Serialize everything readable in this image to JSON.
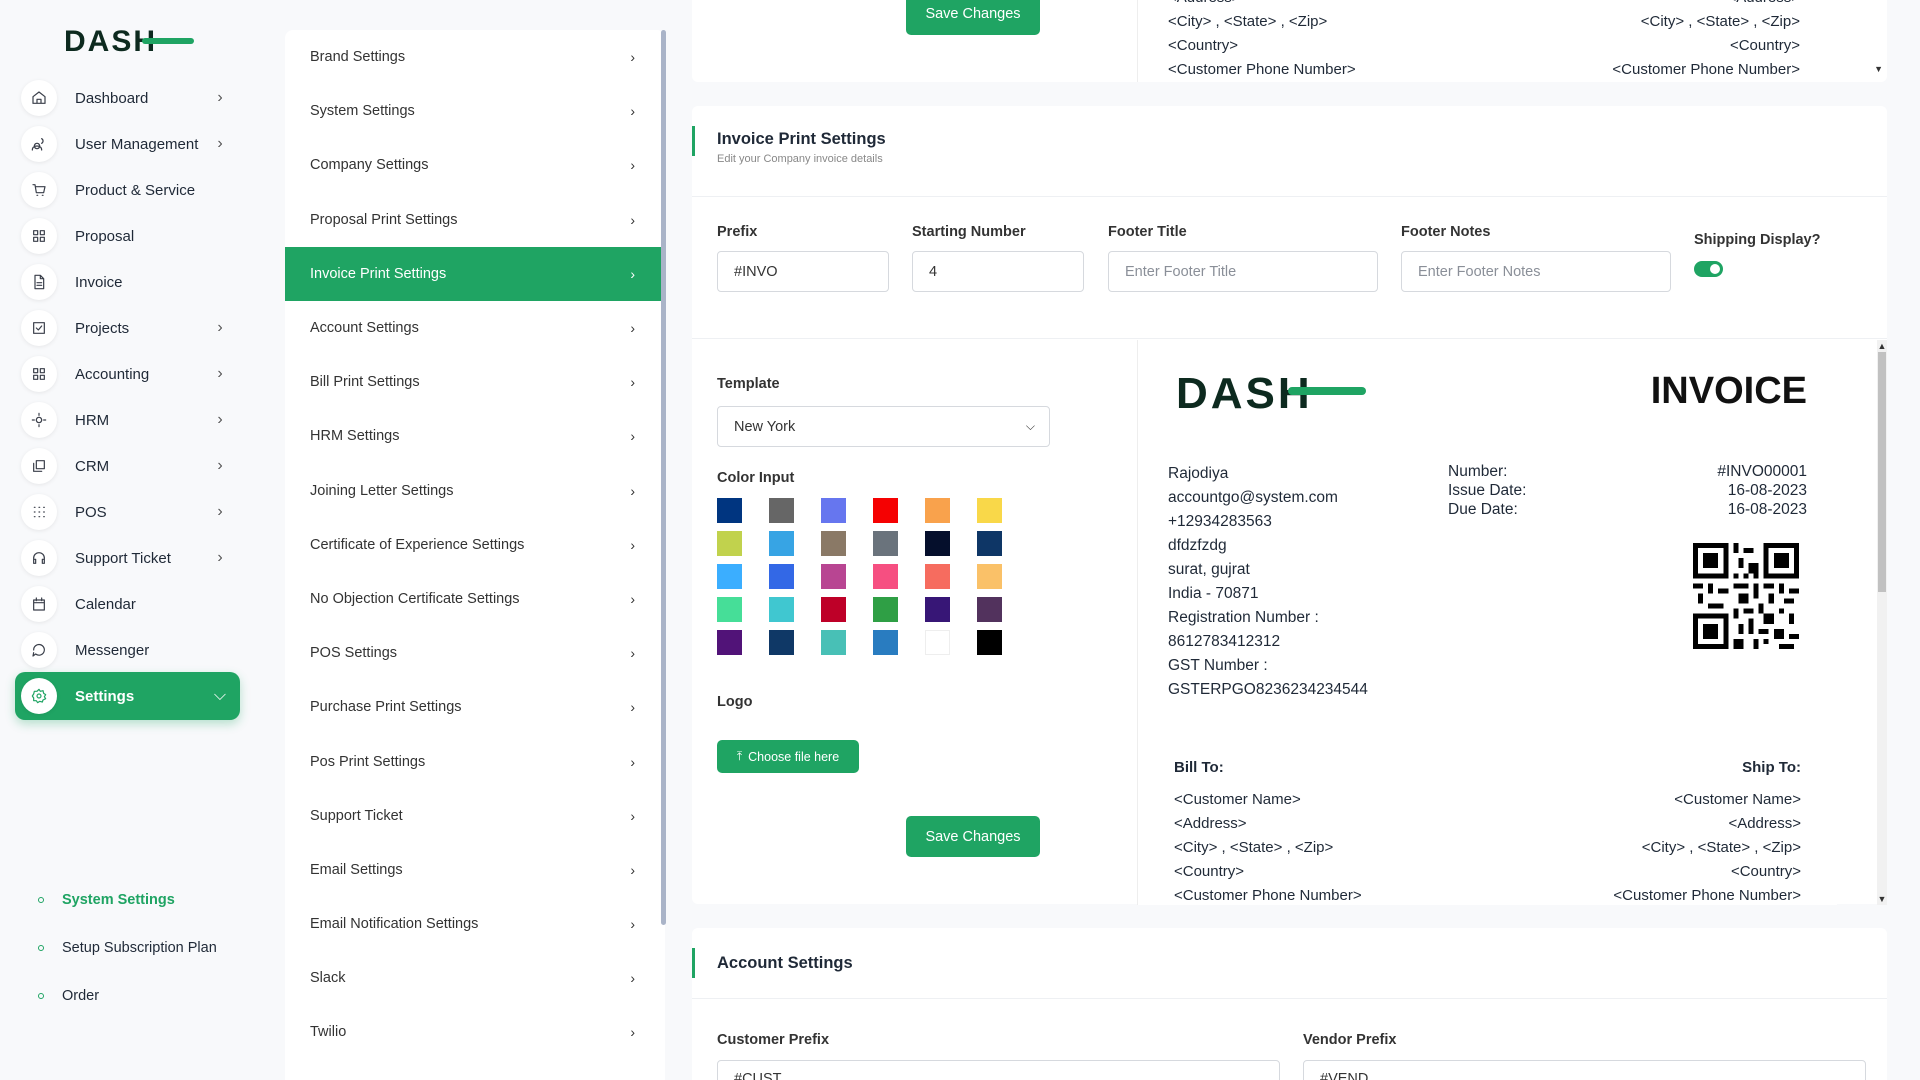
{
  "sidebar": {
    "logo_alt": "DASH",
    "items": [
      {
        "label": "Dashboard",
        "icon": "home-icon",
        "chevron": true
      },
      {
        "label": "User Management",
        "icon": "users-icon",
        "chevron": true
      },
      {
        "label": "Product & Service",
        "icon": "cart-icon",
        "chevron": false
      },
      {
        "label": "Proposal",
        "icon": "proposal-icon",
        "chevron": false
      },
      {
        "label": "Invoice",
        "icon": "file-icon",
        "chevron": false
      },
      {
        "label": "Projects",
        "icon": "check-square-icon",
        "chevron": true
      },
      {
        "label": "Accounting",
        "icon": "grid-icon",
        "chevron": true
      },
      {
        "label": "HRM",
        "icon": "hrm-icon",
        "chevron": true
      },
      {
        "label": "CRM",
        "icon": "layers-icon",
        "chevron": true
      },
      {
        "label": "POS",
        "icon": "dots-grid-icon",
        "chevron": true
      },
      {
        "label": "Support Ticket",
        "icon": "headphones-icon",
        "chevron": true
      },
      {
        "label": "Calendar",
        "icon": "calendar-icon",
        "chevron": false
      },
      {
        "label": "Messenger",
        "icon": "message-icon",
        "chevron": false
      },
      {
        "label": "Settings",
        "icon": "gear-icon",
        "chevron": true,
        "active": true
      }
    ],
    "sub_items": [
      {
        "label": "System Settings",
        "active": true
      },
      {
        "label": "Setup Subscription Plan",
        "active": false
      },
      {
        "label": "Order",
        "active": false
      }
    ]
  },
  "settings_list": [
    "Brand Settings",
    "System Settings",
    "Company Settings",
    "Proposal Print Settings",
    "Invoice Print Settings",
    "Account Settings",
    "Bill Print Settings",
    "HRM Settings",
    "Joining Letter Settings",
    "Certificate of Experience Settings",
    "No Objection Certificate Settings",
    "POS Settings",
    "Purchase Print Settings",
    "Pos Print Settings",
    "Support Ticket",
    "Email Settings",
    "Email Notification Settings",
    "Slack",
    "Twilio"
  ],
  "settings_list_active": "Invoice Print Settings",
  "top_card": {
    "save_label": "Save Changes",
    "left_lines": [
      "<Address>",
      "<City> , <State> , <Zip>",
      "<Country>",
      "<Customer Phone Number>"
    ],
    "right_lines": [
      "<Address>",
      "<City> , <State> , <Zip>",
      "<Country>",
      "<Customer Phone Number>"
    ]
  },
  "invoice_settings": {
    "title": "Invoice Print Settings",
    "subtitle": "Edit your Company invoice details",
    "prefix_label": "Prefix",
    "prefix_value": "#INVO",
    "starting_number_label": "Starting Number",
    "starting_number_value": "4",
    "footer_title_label": "Footer Title",
    "footer_title_placeholder": "Enter Footer Title",
    "footer_notes_label": "Footer Notes",
    "footer_notes_placeholder": "Enter Footer Notes",
    "shipping_label": "Shipping Display?",
    "shipping_on": true,
    "template_label": "Template",
    "template_value": "New York",
    "color_label": "Color Input",
    "colors": [
      "#003580",
      "#666666",
      "#6676ef",
      "#f50102",
      "#f9a24c",
      "#f9d849",
      "#c1d24d",
      "#37a4e4",
      "#8a7966",
      "#6a737c",
      "#050f2c",
      "#0e3666",
      "#3baeff",
      "#3368e6",
      "#b84592",
      "#f64f81",
      "#f66c5f",
      "#fac168",
      "#46de98",
      "#40c7d0",
      "#be0028",
      "#2f9f45",
      "#371676",
      "#52325d",
      "#511378",
      "#0f3866",
      "#48c0b6",
      "#297cc0",
      "#ffffff",
      "#000000"
    ],
    "logo_label": "Logo",
    "choose_file_label": "Choose file here",
    "save_label": "Save Changes"
  },
  "invoice_preview": {
    "heading": "INVOICE",
    "company_lines": [
      "Rajodiya",
      "accountgo@system.com",
      "+12934283563",
      "dfdzfzdg",
      "surat, gujrat",
      "India - 70871",
      "Registration Number :",
      "8612783412312",
      "GST Number :",
      "GSTERPGO8236234234544"
    ],
    "meta_labels": [
      "Number:",
      "Issue Date:",
      "Due Date:"
    ],
    "meta_values": [
      "#INVO00001",
      "16-08-2023",
      "16-08-2023"
    ],
    "bill_to": "Bill To:",
    "ship_to": "Ship To:",
    "bill_lines": [
      "<Customer Name>",
      "<Address>",
      "<City> , <State> , <Zip>",
      "<Country>",
      "<Customer Phone Number>"
    ],
    "ship_lines": [
      "<Customer Name>",
      "<Address>",
      "<City> , <State> , <Zip>",
      "<Country>",
      "<Customer Phone Number>"
    ]
  },
  "account_settings": {
    "title": "Account Settings",
    "customer_prefix_label": "Customer Prefix",
    "customer_prefix_value": "#CUST",
    "vendor_prefix_label": "Vendor Prefix",
    "vendor_prefix_value": "#VEND"
  },
  "brand_color": "#1fa463"
}
